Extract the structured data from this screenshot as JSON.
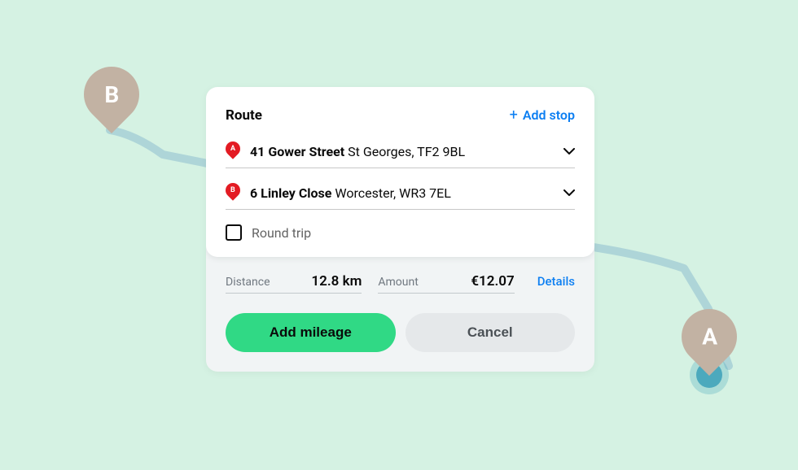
{
  "route": {
    "title": "Route",
    "add_stop_label": "Add stop",
    "stops": [
      {
        "pin": "A",
        "street": "41 Gower Street",
        "locality": " St Georges, TF2 9BL"
      },
      {
        "pin": "B",
        "street": "6 Linley Close",
        "locality": " Worcester, WR3 7EL"
      }
    ],
    "round_trip_label": "Round trip"
  },
  "summary": {
    "distance_label": "Distance",
    "distance_value": "12.8 km",
    "amount_label": "Amount",
    "amount_value": "€12.07",
    "details_label": "Details"
  },
  "buttons": {
    "primary": "Add mileage",
    "secondary": "Cancel"
  },
  "map": {
    "pin_a": "A",
    "pin_b": "B"
  }
}
